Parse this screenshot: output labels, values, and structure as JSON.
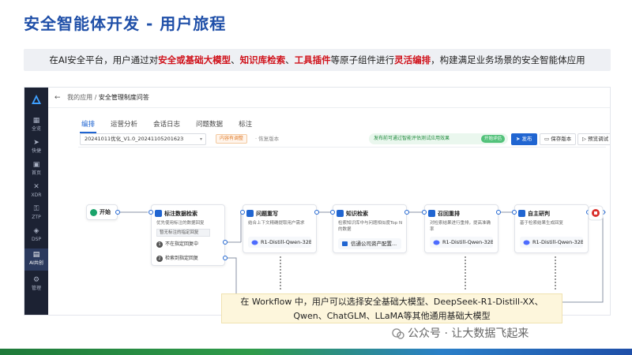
{
  "slide": {
    "title": "安全智能体开发 - 用户旅程",
    "subtitle": {
      "p1": "在AI安全平台，用户通过对",
      "h1": "安全或基础大模型",
      "s1": "、",
      "h2": "知识库检索",
      "s2": "、",
      "h3": "工具插件",
      "p2": "等原子组件进行",
      "h4": "灵活编排",
      "p3": "，构建满足业务场景的安全智能体应用"
    },
    "callout_line1": "在 Workflow 中，用户可以选择安全基础大模型、DeepSeek-R1-Distill-XX、",
    "callout_line2": "Qwen、ChatGLM、LLaMA等其他通用基础大模型",
    "watermark": "公众号 · 让大数据飞起来"
  },
  "sidebar": {
    "items": [
      {
        "label": "全览",
        "icon": "grid-icon"
      },
      {
        "label": "快捷",
        "icon": "send-icon"
      },
      {
        "label": "首页",
        "icon": "home-icon"
      },
      {
        "label": "XDR",
        "icon": "x-icon"
      },
      {
        "label": "ZTP",
        "icon": "lock-icon"
      },
      {
        "label": "DSP",
        "icon": "shield-icon"
      },
      {
        "label": "AI共创",
        "icon": "ai-icon"
      },
      {
        "label": "管理",
        "icon": "gear-icon"
      }
    ]
  },
  "topbar": {
    "breadcrumb_root": "我的应用",
    "separator": "/",
    "breadcrumb_current": "安全管理制度问答"
  },
  "tabs": [
    "编排",
    "运营分析",
    "会话日志",
    "问题数据",
    "标注"
  ],
  "toolbar": {
    "version": "20241011优化_V1.0_20241105201623",
    "status_tag": "内容有调整",
    "restore": "· 恢复版本",
    "notice": "发布前可通过智能评估测试应用效果",
    "notice_button": "开始评估",
    "publish": "发布",
    "save_version": "保存版本",
    "preview": "预览调试"
  },
  "flow": {
    "start": "开始",
    "retrieval": {
      "title": "标注数据检索",
      "desc": "优先使用标注的数据回复",
      "tag": "暂无标注的指定回复",
      "cond1": "不在指定回复中",
      "cond2": "检索到指定回复"
    },
    "rewrite": {
      "title": "问题重写",
      "desc": "结合上下文精确提取用户需求",
      "model": "R1-Distill-Qwen-32B"
    },
    "knowledge": {
      "title": "知识检索",
      "desc": "检索知识库中与问题相似度Top N的数据",
      "source": "信通公司资产配置..."
    },
    "rerank": {
      "title": "召回重排",
      "desc": "对检索结果进行重排，提高准确率",
      "model": "R1-Distill-Qwen-32B"
    },
    "research": {
      "title": "自主研判",
      "desc": "基于检索结果生成回复",
      "model": "R1-Distill-Qwen-32B"
    }
  },
  "colors": {
    "title_blue": "#1f4fa8",
    "highlight_red": "#d0121b",
    "primary": "#2065d1",
    "sidebar_bg": "#1c2233"
  }
}
